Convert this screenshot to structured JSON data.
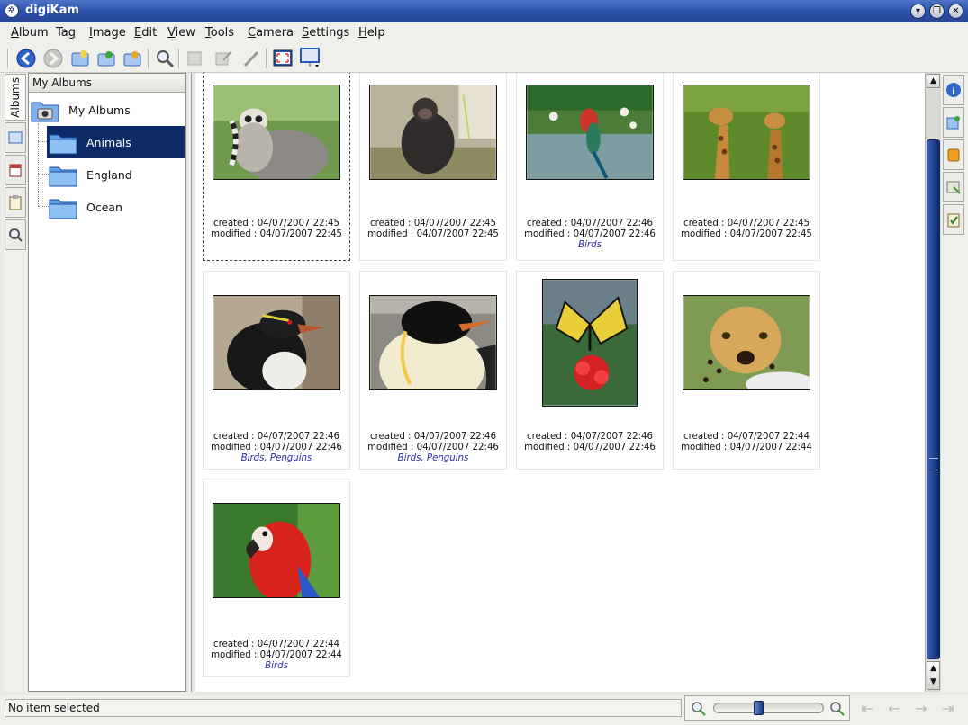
{
  "window": {
    "title": "digiKam"
  },
  "menu": [
    {
      "pre": "",
      "u": "A",
      "post": "lbum"
    },
    {
      "pre": "Ta",
      "u": "g",
      "post": ""
    },
    {
      "pre": "",
      "u": "I",
      "post": "mage"
    },
    {
      "pre": "",
      "u": "E",
      "post": "dit"
    },
    {
      "pre": "",
      "u": "V",
      "post": "iew"
    },
    {
      "pre": "",
      "u": "T",
      "post": "ools"
    },
    {
      "pre": "",
      "u": "C",
      "post": "amera"
    },
    {
      "pre": "",
      "u": "S",
      "post": "ettings"
    },
    {
      "pre": "",
      "u": "H",
      "post": "elp"
    }
  ],
  "toolbar": [
    "back-arrow-icon",
    "forward-arrow-icon",
    "new-album-icon",
    "import-icon",
    "export-icon",
    "search-icon",
    "properties-icon",
    "edit-icon",
    "pencil-icon",
    "fullscreen-icon",
    "slideshow-icon"
  ],
  "left_tabs": {
    "albums": "Albums"
  },
  "album_panel": {
    "header": "My Albums",
    "root": "My Albums",
    "albums": [
      "Animals",
      "England",
      "Ocean"
    ],
    "selected": "Animals"
  },
  "items": [
    {
      "created": "created : 04/07/2007 22:45",
      "modified": "modified : 04/07/2007 22:45",
      "tags": "",
      "photo": "lemur"
    },
    {
      "created": "created : 04/07/2007 22:45",
      "modified": "modified : 04/07/2007 22:45",
      "tags": "",
      "photo": "chimpanzee"
    },
    {
      "created": "created : 04/07/2007 22:46",
      "modified": "modified : 04/07/2007 22:46",
      "tags": "Birds",
      "photo": "parrot-lake"
    },
    {
      "created": "created : 04/07/2007 22:45",
      "modified": "modified : 04/07/2007 22:45",
      "tags": "",
      "photo": "giraffes"
    },
    {
      "created": "created : 04/07/2007 22:46",
      "modified": "modified : 04/07/2007 22:46",
      "tags": "Birds, Penguins",
      "photo": "rockhopper-penguin"
    },
    {
      "created": "created : 04/07/2007 22:46",
      "modified": "modified : 04/07/2007 22:46",
      "tags": "Birds, Penguins",
      "photo": "emperor-penguin"
    },
    {
      "created": "created : 04/07/2007 22:46",
      "modified": "modified : 04/07/2007 22:46",
      "tags": "",
      "photo": "butterfly"
    },
    {
      "created": "created : 04/07/2007 22:44",
      "modified": "modified : 04/07/2007 22:44",
      "tags": "",
      "photo": "cheetah"
    },
    {
      "created": "created : 04/07/2007 22:44",
      "modified": "modified : 04/07/2007 22:44",
      "tags": "Birds",
      "photo": "macaw"
    }
  ],
  "status": {
    "text": "No item selected",
    "zoom_level_fraction": 0.4
  },
  "colors": {
    "selection": "#0e2a66",
    "tag_text": "#2a2aa8",
    "titlebar": "#2a4ea8"
  }
}
